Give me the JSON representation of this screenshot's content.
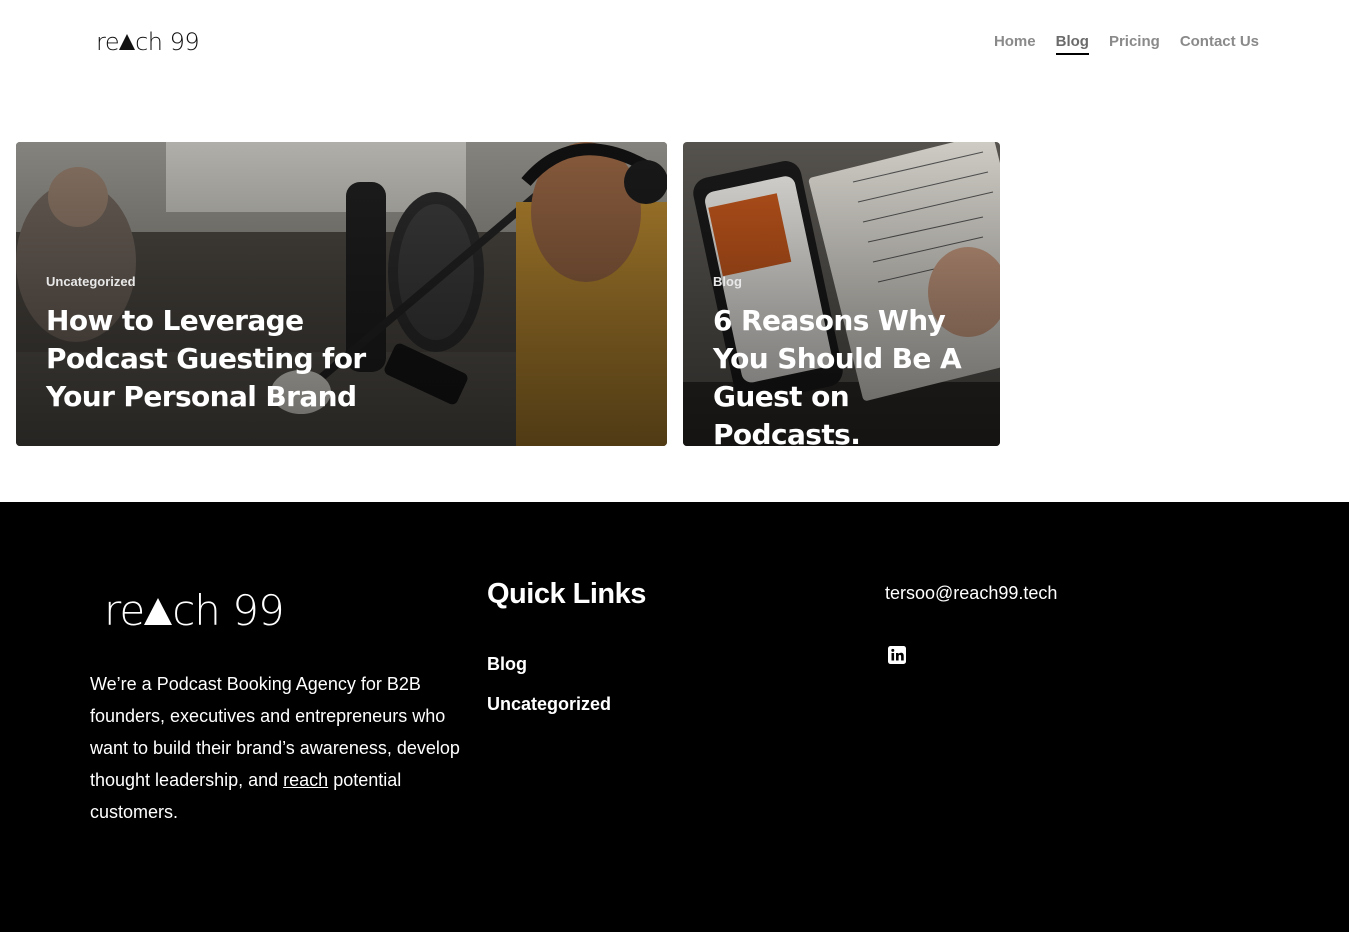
{
  "header": {
    "logo": {
      "left": "re",
      "right": "ch 99"
    },
    "nav": [
      {
        "label": "Home",
        "active": false
      },
      {
        "label": "Blog",
        "active": true
      },
      {
        "label": "Pricing",
        "active": false
      },
      {
        "label": "Contact Us",
        "active": false
      }
    ]
  },
  "posts": [
    {
      "category": "Uncategorized",
      "title": "How to Leverage Podcast Guesting for Your Personal Brand",
      "image": "podcast-studio-photo"
    },
    {
      "category": "Blog",
      "title": "6 Reasons Why You Should Be A Guest on Podcasts.",
      "image": "phone-and-notebook-photo"
    }
  ],
  "footer": {
    "logo": {
      "left": "re",
      "right": "ch 99"
    },
    "about": {
      "before": "We’re a Podcast Booking Agency for B2B founders, executives and entrepreneurs who want to build their brand’s awareness, develop thought leadership, and ",
      "link": "reach",
      "after": " potential customers."
    },
    "quick_links_title": "Quick Links",
    "quick_links": [
      "Blog",
      "Uncategorized"
    ],
    "email": "tersoo@reach99.tech",
    "social_icon": "linkedin-icon"
  },
  "colors": {
    "footer_bg": "#000000",
    "nav_text": "#8a8a8a",
    "text_white": "#ffffff"
  }
}
